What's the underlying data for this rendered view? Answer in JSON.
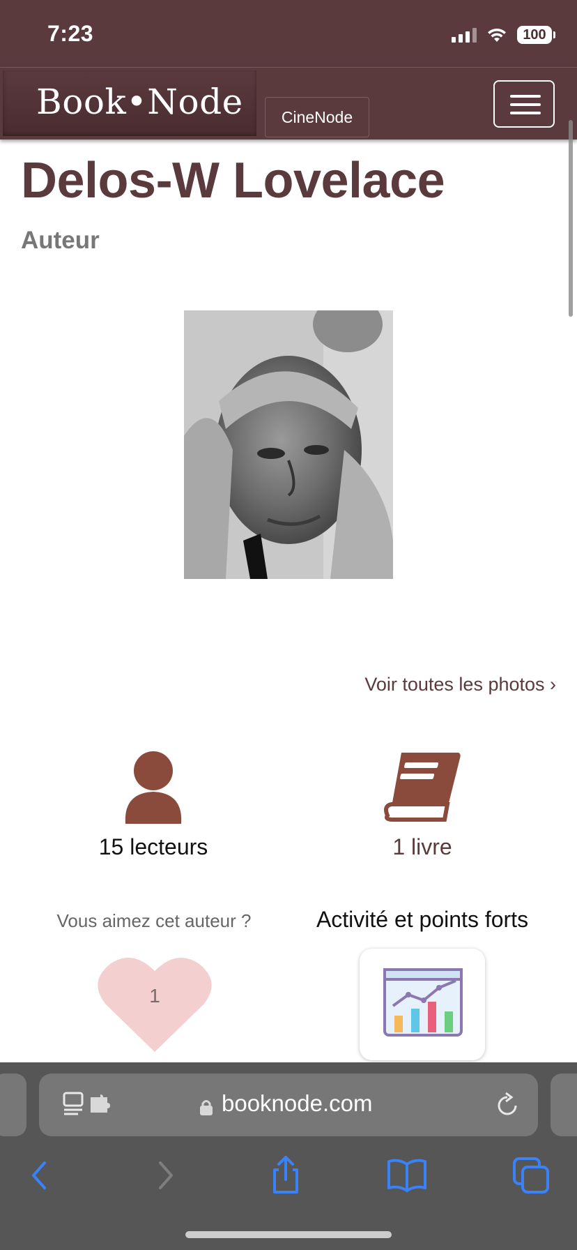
{
  "status_bar": {
    "time": "7:23",
    "battery": "100"
  },
  "navbar": {
    "brand": "Book•Node",
    "tab_cinenode": "CineNode",
    "menu_icon": "hamburger-icon"
  },
  "author": {
    "name": "Delos-W Lovelace",
    "role": "Auteur"
  },
  "photos_link": "Voir toutes les photos ›",
  "stats": {
    "readers_label": "15 lecteurs",
    "books_label": "1 livre"
  },
  "like": {
    "prompt": "Vous aimez cet auteur ?",
    "count": "1"
  },
  "activity": {
    "title": "Activité et points forts"
  },
  "safari": {
    "url": "booknode.com"
  },
  "colors": {
    "brand": "#5b3a3e",
    "icon_brown": "#8a4b3c",
    "heart_pink": "#f3cfcf",
    "safari_blue": "#3a82f7"
  }
}
